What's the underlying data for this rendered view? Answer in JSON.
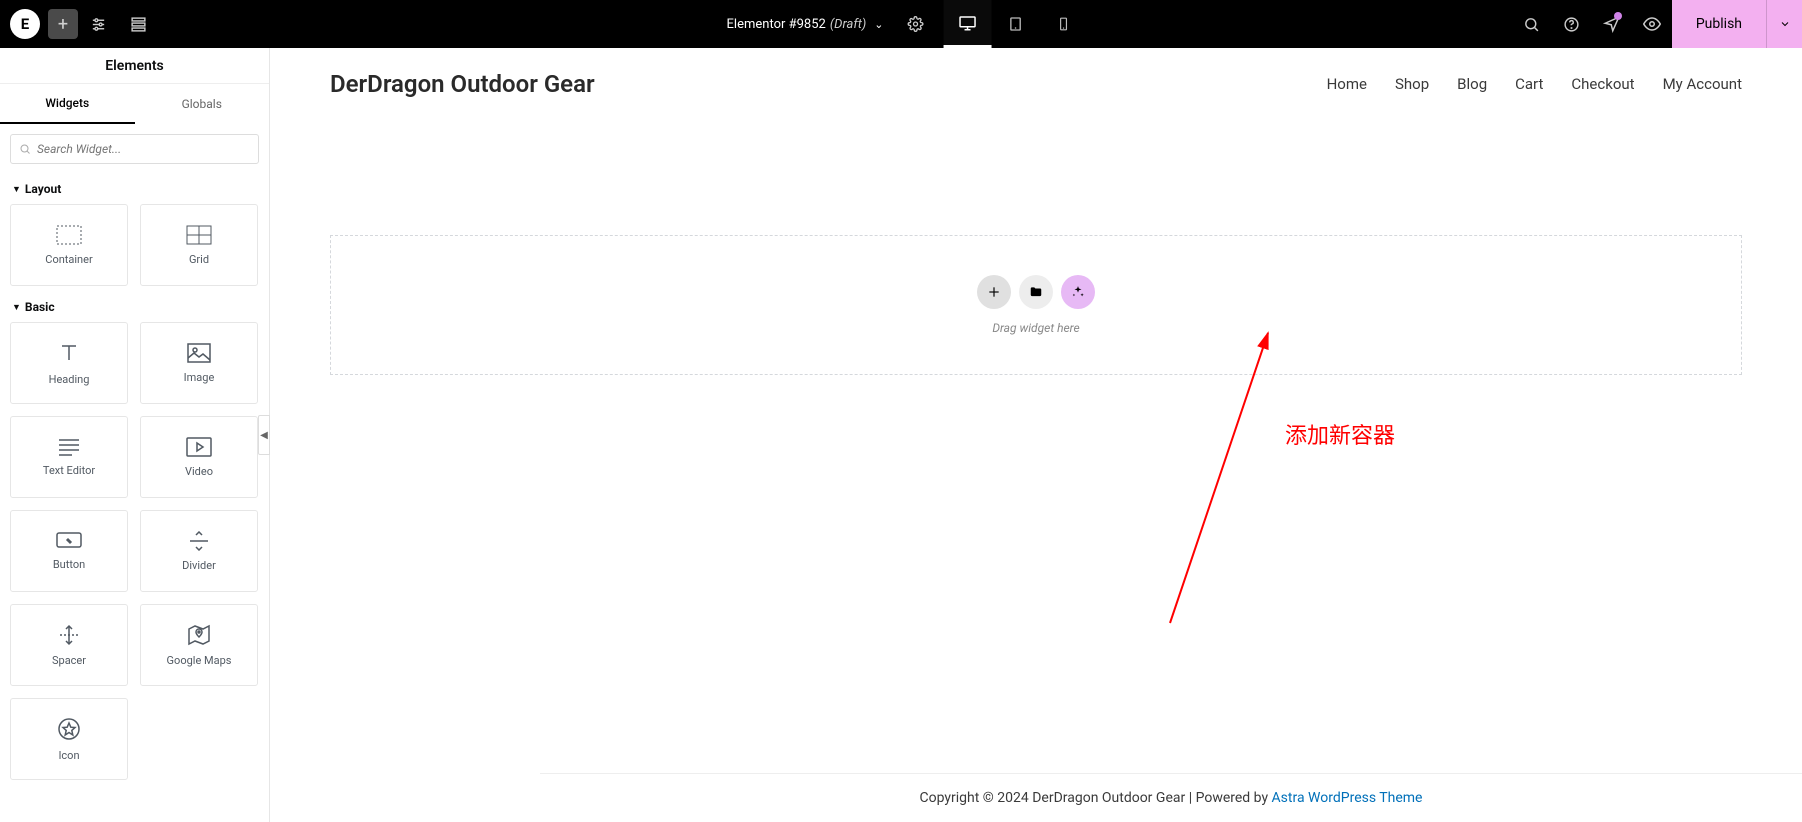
{
  "topbar": {
    "logo": "E",
    "doc_title_prefix": "Elementor #9852",
    "doc_title_status": "(Draft)",
    "publish_label": "Publish"
  },
  "sidebar": {
    "header": "Elements",
    "tabs": {
      "widgets": "Widgets",
      "globals": "Globals"
    },
    "search_placeholder": "Search Widget...",
    "sections": {
      "layout": {
        "title": "Layout",
        "items": [
          "Container",
          "Grid"
        ]
      },
      "basic": {
        "title": "Basic",
        "items": [
          "Heading",
          "Image",
          "Text Editor",
          "Video",
          "Button",
          "Divider",
          "Spacer",
          "Google Maps",
          "Icon"
        ]
      }
    }
  },
  "page": {
    "site_title": "DerDragon Outdoor Gear",
    "nav": [
      "Home",
      "Shop",
      "Blog",
      "Cart",
      "Checkout",
      "My Account"
    ],
    "drop_hint": "Drag widget here",
    "annotation": "添加新容器",
    "footer_prefix": "Copyright © 2024 DerDragon Outdoor Gear | Powered by ",
    "footer_link": "Astra WordPress Theme"
  }
}
